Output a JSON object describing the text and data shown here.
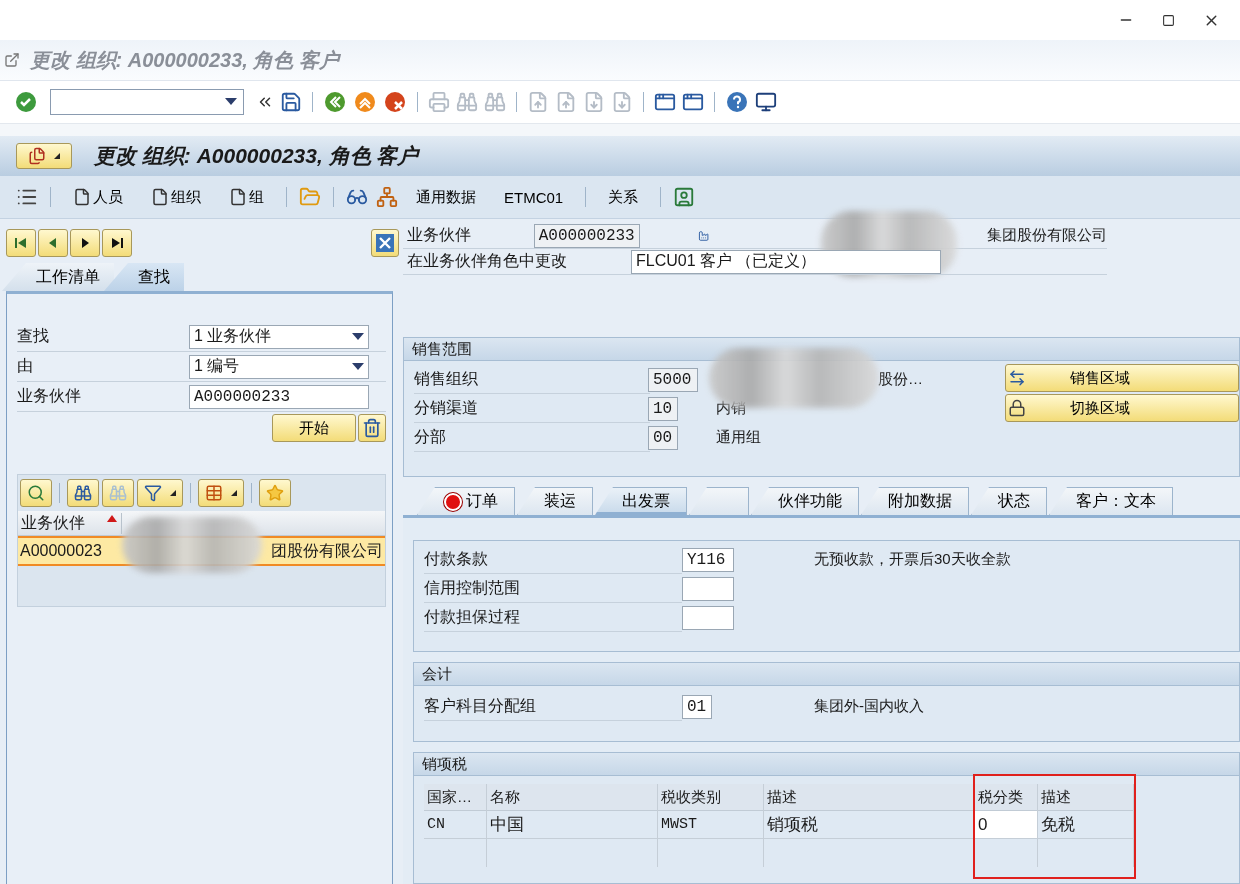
{
  "title": "更改 组织: A000000233, 角色 客户",
  "header": {
    "title": "更改 组织: A000000233, 角色 客户"
  },
  "app_toolbar": [
    {
      "label": "人员",
      "kind": "doc"
    },
    {
      "label": "组织",
      "kind": "doc"
    },
    {
      "label": "组",
      "kind": "doc"
    },
    {
      "label": "通用数据",
      "kind": "text"
    },
    {
      "label": "ETMC01",
      "kind": "text"
    },
    {
      "label": "关系",
      "kind": "text"
    }
  ],
  "worklist": {
    "tabs": [
      {
        "label": "工作清单",
        "selected": false
      },
      {
        "label": "查找",
        "selected": true
      }
    ],
    "fields": [
      {
        "label": "查找",
        "value": "1 业务伙伴",
        "kind": "dropdown"
      },
      {
        "label": "由",
        "value": "1 编号",
        "kind": "dropdown"
      },
      {
        "label": "业务伙伴",
        "value": "A000000233",
        "kind": "input"
      }
    ],
    "start_button": "开始",
    "result_columns": [
      {
        "label": "业务伙伴",
        "sorted": true
      }
    ],
    "result_rows": [
      {
        "cells": [
          "A00000023",
          "团股份有限公司"
        ],
        "selected": true
      }
    ]
  },
  "partner": {
    "label": "业务伙伴",
    "value": "A000000233",
    "name": "集团股份有限公司"
  },
  "role": {
    "label": "在业务伙伴角色中更改",
    "value": "FLCU01 客户 （已定义）"
  },
  "sales_area": {
    "title": "销售范围",
    "rows": [
      {
        "label": "销售组织",
        "value": "5000",
        "text": "股份…"
      },
      {
        "label": "分销渠道",
        "value": "10",
        "text": "内销"
      },
      {
        "label": "分部",
        "value": "00",
        "text": "通用组"
      }
    ],
    "buttons": [
      "销售区域",
      "切换区域"
    ]
  },
  "tabs": [
    {
      "label": "订单",
      "selected": false,
      "alert": true
    },
    {
      "label": "装运",
      "selected": false,
      "alert": false
    },
    {
      "label": "出发票",
      "selected": true,
      "alert": false
    },
    {
      "selected": false,
      "alert": false
    },
    {
      "label": "伙伴功能",
      "selected": false,
      "alert": false
    },
    {
      "label": "附加数据",
      "selected": false,
      "alert": false
    },
    {
      "label": "状态",
      "selected": false,
      "alert": false
    },
    {
      "label": "客户：文本",
      "selected": false,
      "alert": false
    }
  ],
  "billing": {
    "fields": [
      {
        "label": "付款条款",
        "value": "Y116",
        "text": "无预收款，开票后30天收全款"
      },
      {
        "label": "信用控制范围"
      },
      {
        "label": "付款担保过程"
      }
    ]
  },
  "accounting": {
    "title": "会计",
    "fields": [
      {
        "label": "客户科目分配组",
        "value": "01",
        "text": "集团外-国内收入"
      }
    ]
  },
  "output_tax": {
    "title": "销项税",
    "columns": [
      {
        "label": "国家…",
        "highlighted": false,
        "editable": false
      },
      {
        "label": "名称",
        "highlighted": false,
        "editable": false
      },
      {
        "label": "税收类别",
        "highlighted": false,
        "editable": false
      },
      {
        "label": "描述",
        "highlighted": false,
        "editable": false
      },
      {
        "label": "税分类",
        "highlighted": true,
        "editable": true
      },
      {
        "label": "描述",
        "highlighted": true,
        "editable": false
      }
    ],
    "rows": [
      {
        "cells": [
          "CN",
          "中国",
          "MWST",
          "销项税",
          "0",
          "免税"
        ]
      }
    ]
  }
}
